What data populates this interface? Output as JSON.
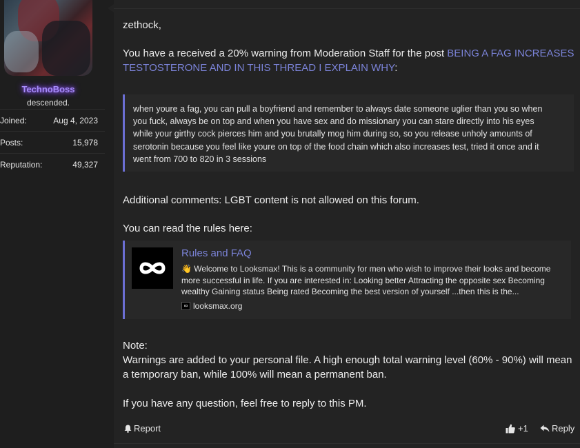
{
  "user": {
    "name": "TechnoBoss",
    "title": "descended.",
    "stats": [
      {
        "label": "Joined:",
        "value": "Aug 4, 2023"
      },
      {
        "label": "Posts:",
        "value": "15,978"
      },
      {
        "label": "Reputation:",
        "value": "49,327"
      }
    ]
  },
  "message": {
    "greeting": "zethock,",
    "warning_line1_prefix": "You have a received a 20% warning from Moderation Staff for the post ",
    "warning_link_part1": "BEING A FAG INCREASES",
    "warning_link_part2": "TESTOSTERONE AND IN THIS THREAD I EXPLAIN WHY",
    "warning_suffix": ":",
    "quote": [
      "when youre a fag, you can pull a boyfriend and remember to always date someone uglier than you so when",
      "you fuck, always be on top and when you have sex and do missionary you can stare directly into his eyes",
      "while your girthy cock pierces him and you brutally mog him during so, so you release unholy amounts of",
      "serotonin because you feel like youre on top of the food chain which also increases test, tried it once and it",
      "went from 700 to 820 in 3 sessions"
    ],
    "additional_comments": "Additional comments: LGBT content is not allowed on this forum.",
    "rules_intro": "You can read the rules here:",
    "embed": {
      "title": "Rules and FAQ",
      "desc_lines": [
        "👋 Welcome to Looksmax! This is a community for men who wish to improve their looks and become",
        "more successful in life. If you are interested in: Looking better Attracting the opposite sex Becoming",
        "wealthy Gaining status Being rated Becoming the best version of yourself ...then this is the..."
      ],
      "site": "looksmax.org",
      "logo_icon": "infinity-icon"
    },
    "note_label": "Note:",
    "note_line1": "Warnings are added to your personal file. A high enough total warning level (60% - 90%) will mean",
    "note_line2": "a temporary ban, while 100% will mean a permanent ban.",
    "closing": "If you have any question, feel free to reply to this PM."
  },
  "actions": {
    "report": "Report",
    "like_count": "+1",
    "reply": "Reply"
  },
  "colors": {
    "link": "#7b83d8",
    "username_glow": "#a78bfa",
    "quote_border": "#6c6fd4"
  }
}
